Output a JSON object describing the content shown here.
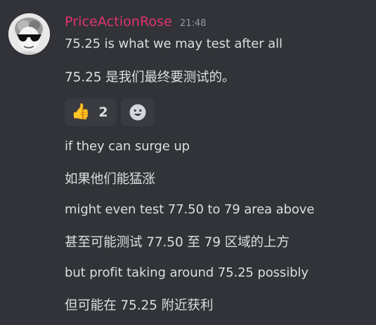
{
  "message": {
    "author": "PriceActionRose",
    "timestamp": "21:48",
    "author_color": "#e0326e",
    "lines": [
      "75.25 is what we may test after all",
      "75.25 是我们最终要测试的。",
      "if they can surge up",
      "如果他们能猛涨",
      "might even test 77.50 to 79 area above",
      "甚至可能测试 77.50 至 79 区域的上方",
      "but profit taking around 75.25 possibly",
      "但可能在 75.25 附近获利"
    ]
  },
  "reactions": {
    "thumbs_up": {
      "emoji": "👍",
      "count": "2"
    },
    "add_reaction": {
      "icon": "add-reaction-smiley-icon"
    }
  },
  "colors": {
    "background": "#313338",
    "text": "#dbdee1",
    "muted": "#949ba4",
    "reaction_bg": "#393b41"
  }
}
